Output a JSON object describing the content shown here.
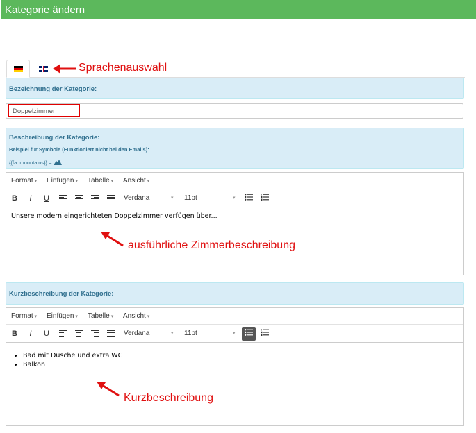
{
  "header": {
    "title": "Kategorie ändern"
  },
  "tabs": [
    {
      "flag": "flag-germany-icon",
      "active": true
    },
    {
      "flag": "flag-uk-icon",
      "active": false
    }
  ],
  "annotations": {
    "language": "Sprachenauswahl",
    "long_desc": "ausführliche Zimmerbeschreibung",
    "short_desc": "Kurzbeschreibung"
  },
  "name_section": {
    "label": "Bezeichnung der Kategorie:",
    "value": "Doppelzimmer"
  },
  "desc_section": {
    "label": "Beschreibung der Kategorie:",
    "symbol_hint": "Beispiel für Symbole (Funktioniert nicht bei den Emails):",
    "symbol_example": "{{fa::mountains}} ="
  },
  "short_section": {
    "label": "Kurzbeschreibung der Kategorie:"
  },
  "editor_menu": [
    "Format",
    "Einfügen",
    "Tabelle",
    "Ansicht"
  ],
  "editor_toolbar": {
    "bold": "B",
    "italic": "I",
    "underline": "U",
    "font": "Verdana",
    "size": "11pt"
  },
  "long_editor": {
    "text": "Unsere modern eingerichteten Doppelzimmer verfügen über..."
  },
  "short_editor": {
    "items": [
      "Bad mit Dusche und extra WC",
      "Balkon"
    ]
  },
  "colors": {
    "header": "#5cb85c",
    "panel": "#d9edf7",
    "panel_text": "#31708f",
    "annotation": "#e01010"
  }
}
